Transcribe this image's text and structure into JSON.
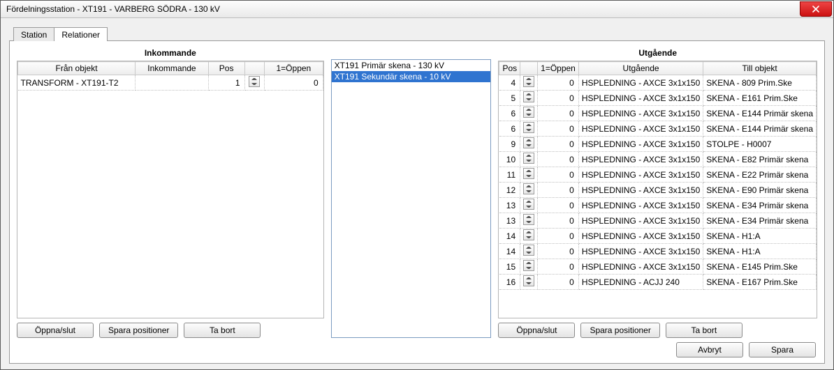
{
  "window": {
    "title": "Fördelningsstation - XT191 - VARBERG SÖDRA - 130 kV"
  },
  "tabs": {
    "station": "Station",
    "relationer": "Relationer"
  },
  "incoming": {
    "title": "Inkommande",
    "headers": {
      "from": "Från objekt",
      "incoming": "Inkommande",
      "pos": "Pos",
      "open": "1=Öppen"
    },
    "rows": [
      {
        "from": "TRANSFORM - XT191-T2",
        "incoming": "",
        "pos": "1",
        "open": "0"
      }
    ],
    "buttons": {
      "open": "Öppna/slut",
      "save": "Spara positioner",
      "remove": "Ta bort"
    }
  },
  "busbars": {
    "items": [
      {
        "label": "XT191 Primär skena - 130 kV",
        "selected": false
      },
      {
        "label": "XT191 Sekundär skena - 10 kV",
        "selected": true
      }
    ]
  },
  "outgoing": {
    "title": "Utgående",
    "headers": {
      "pos": "Pos",
      "open": "1=Öppen",
      "outgoing": "Utgående",
      "to": "Till objekt"
    },
    "rows": [
      {
        "pos": "4",
        "open": "0",
        "outgoing": "HSPLEDNING - AXCE 3x1x150",
        "to": "SKENA - 809 Prim.Ske"
      },
      {
        "pos": "5",
        "open": "0",
        "outgoing": "HSPLEDNING - AXCE 3x1x150",
        "to": "SKENA - E161 Prim.Ske"
      },
      {
        "pos": "6",
        "open": "0",
        "outgoing": "HSPLEDNING - AXCE 3x1x150",
        "to": "SKENA - E144 Primär skena"
      },
      {
        "pos": "6",
        "open": "0",
        "outgoing": "HSPLEDNING - AXCE 3x1x150",
        "to": "SKENA - E144 Primär skena"
      },
      {
        "pos": "9",
        "open": "0",
        "outgoing": "HSPLEDNING - AXCE 3x1x150",
        "to": "STOLPE - H0007"
      },
      {
        "pos": "10",
        "open": "0",
        "outgoing": "HSPLEDNING - AXCE 3x1x150",
        "to": "SKENA - E82 Primär skena"
      },
      {
        "pos": "11",
        "open": "0",
        "outgoing": "HSPLEDNING - AXCE 3x1x150",
        "to": "SKENA - E22 Primär skena"
      },
      {
        "pos": "12",
        "open": "0",
        "outgoing": "HSPLEDNING - AXCE 3x1x150",
        "to": "SKENA - E90 Primär skena"
      },
      {
        "pos": "13",
        "open": "0",
        "outgoing": "HSPLEDNING - AXCE 3x1x150",
        "to": "SKENA - E34 Primär skena"
      },
      {
        "pos": "13",
        "open": "0",
        "outgoing": "HSPLEDNING - AXCE 3x1x150",
        "to": "SKENA - E34 Primär skena"
      },
      {
        "pos": "14",
        "open": "0",
        "outgoing": "HSPLEDNING - AXCE 3x1x150",
        "to": "SKENA - H1:A"
      },
      {
        "pos": "14",
        "open": "0",
        "outgoing": "HSPLEDNING - AXCE 3x1x150",
        "to": "SKENA - H1:A"
      },
      {
        "pos": "15",
        "open": "0",
        "outgoing": "HSPLEDNING - AXCE 3x1x150",
        "to": "SKENA - E145 Prim.Ske"
      },
      {
        "pos": "16",
        "open": "0",
        "outgoing": "HSPLEDNING - ACJJ 240",
        "to": "SKENA - E167 Prim.Ske"
      }
    ],
    "buttons": {
      "open": "Öppna/slut",
      "save": "Spara positioner",
      "remove": "Ta bort"
    }
  },
  "footer": {
    "cancel": "Avbryt",
    "save": "Spara"
  }
}
